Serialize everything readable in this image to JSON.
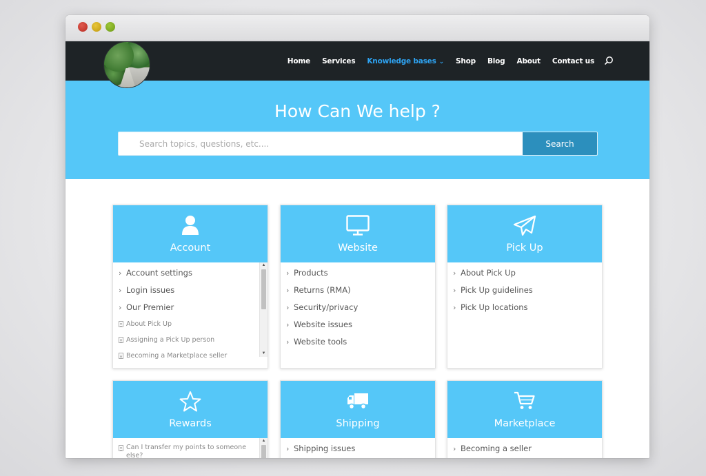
{
  "nav": {
    "items": [
      {
        "label": "Home"
      },
      {
        "label": "Services"
      },
      {
        "label": "Knowledge bases",
        "active": true
      },
      {
        "label": "Shop"
      },
      {
        "label": "Blog"
      },
      {
        "label": "About"
      },
      {
        "label": "Contact us"
      }
    ],
    "search_icon": "search-icon"
  },
  "hero": {
    "title": "How Can We help ?",
    "search_placeholder": "Search topics, questions, etc....",
    "search_value": "",
    "search_button": "Search"
  },
  "colors": {
    "accent": "#55c7f8",
    "button": "#2c8fbd",
    "navbar": "#1e2326",
    "active_link": "#2ea3f2"
  },
  "cards": [
    {
      "title": "Account",
      "icon": "user-icon",
      "items": [
        {
          "label": "Account settings",
          "kind": "category"
        },
        {
          "label": "Login issues",
          "kind": "category"
        },
        {
          "label": "Our Premier",
          "kind": "category"
        },
        {
          "label": "About Pick Up",
          "kind": "article"
        },
        {
          "label": "Assigning a Pick Up person",
          "kind": "article"
        },
        {
          "label": "Becoming a Marketplace seller",
          "kind": "article"
        }
      ]
    },
    {
      "title": "Website",
      "icon": "monitor-icon",
      "items": [
        {
          "label": "Products",
          "kind": "category"
        },
        {
          "label": "Returns (RMA)",
          "kind": "category"
        },
        {
          "label": "Security/privacy",
          "kind": "category"
        },
        {
          "label": "Website issues",
          "kind": "category"
        },
        {
          "label": "Website tools",
          "kind": "category"
        }
      ]
    },
    {
      "title": "Pick Up",
      "icon": "paper-plane-icon",
      "items": [
        {
          "label": "About Pick Up",
          "kind": "category"
        },
        {
          "label": "Pick Up guidelines",
          "kind": "category"
        },
        {
          "label": "Pick Up locations",
          "kind": "category"
        }
      ]
    },
    {
      "title": "Rewards",
      "icon": "star-icon",
      "items": [
        {
          "label": "Can I transfer my points to someone else?",
          "kind": "article"
        }
      ]
    },
    {
      "title": "Shipping",
      "icon": "truck-icon",
      "items": [
        {
          "label": "Shipping issues",
          "kind": "category"
        }
      ]
    },
    {
      "title": "Marketplace",
      "icon": "cart-icon",
      "items": [
        {
          "label": "Becoming a seller",
          "kind": "category"
        }
      ]
    }
  ]
}
